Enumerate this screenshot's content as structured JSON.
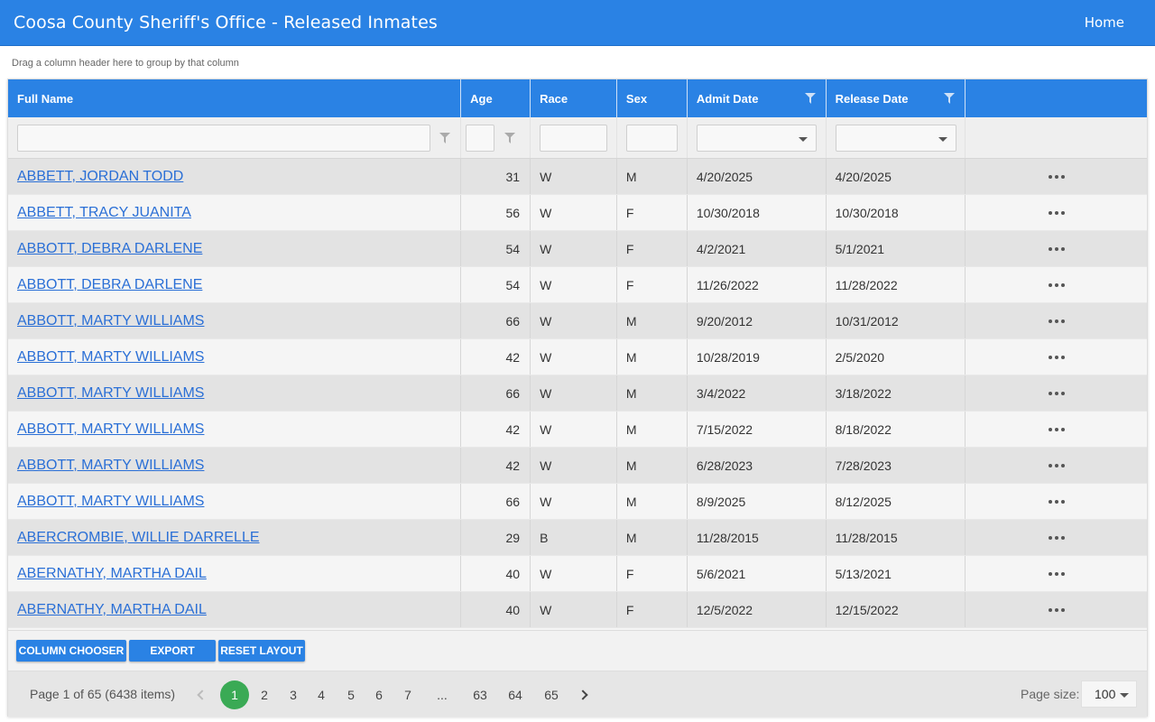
{
  "header": {
    "title": "Coosa County Sheriff's Office - Released Inmates",
    "home_link": "Home"
  },
  "group_hint": "Drag a column header here to group by that column",
  "columns": [
    "Full Name",
    "Age",
    "Race",
    "Sex",
    "Admit Date",
    "Release Date"
  ],
  "rows": [
    {
      "name": "ABBETT, JORDAN TODD",
      "age": "31",
      "race": "W",
      "sex": "M",
      "admit": "4/20/2025",
      "release": "4/20/2025"
    },
    {
      "name": "ABBETT, TRACY JUANITA",
      "age": "56",
      "race": "W",
      "sex": "F",
      "admit": "10/30/2018",
      "release": "10/30/2018"
    },
    {
      "name": "ABBOTT, DEBRA DARLENE",
      "age": "54",
      "race": "W",
      "sex": "F",
      "admit": "4/2/2021",
      "release": "5/1/2021"
    },
    {
      "name": "ABBOTT, DEBRA DARLENE",
      "age": "54",
      "race": "W",
      "sex": "F",
      "admit": "11/26/2022",
      "release": "11/28/2022"
    },
    {
      "name": "ABBOTT, MARTY WILLIAMS",
      "age": "66",
      "race": "W",
      "sex": "M",
      "admit": "9/20/2012",
      "release": "10/31/2012"
    },
    {
      "name": "ABBOTT, MARTY WILLIAMS",
      "age": "42",
      "race": "W",
      "sex": "M",
      "admit": "10/28/2019",
      "release": "2/5/2020"
    },
    {
      "name": "ABBOTT, MARTY WILLIAMS",
      "age": "66",
      "race": "W",
      "sex": "M",
      "admit": "3/4/2022",
      "release": "3/18/2022"
    },
    {
      "name": "ABBOTT, MARTY WILLIAMS",
      "age": "42",
      "race": "W",
      "sex": "M",
      "admit": "7/15/2022",
      "release": "8/18/2022"
    },
    {
      "name": "ABBOTT, MARTY WILLIAMS",
      "age": "42",
      "race": "W",
      "sex": "M",
      "admit": "6/28/2023",
      "release": "7/28/2023"
    },
    {
      "name": "ABBOTT, MARTY WILLIAMS",
      "age": "66",
      "race": "W",
      "sex": "M",
      "admit": "8/9/2025",
      "release": "8/12/2025"
    },
    {
      "name": "ABERCROMBIE, WILLIE DARRELLE",
      "age": "29",
      "race": "B",
      "sex": "M",
      "admit": "11/28/2015",
      "release": "11/28/2015"
    },
    {
      "name": "ABERNATHY, MARTHA DAIL",
      "age": "40",
      "race": "W",
      "sex": "F",
      "admit": "5/6/2021",
      "release": "5/13/2021"
    },
    {
      "name": "ABERNATHY, MARTHA DAIL",
      "age": "40",
      "race": "W",
      "sex": "F",
      "admit": "12/5/2022",
      "release": "12/15/2022"
    }
  ],
  "buttons": {
    "column_chooser": "COLUMN CHOOSER",
    "export": "EXPORT",
    "reset_layout": "RESET LAYOUT"
  },
  "pager": {
    "info": "Page 1 of 65 (6438 items)",
    "pages": [
      "1",
      "2",
      "3",
      "4",
      "5",
      "6",
      "7",
      "...",
      "63",
      "64",
      "65"
    ],
    "current": "1",
    "page_size_label": "Page size:",
    "page_size": "100"
  },
  "colors": {
    "header_bg": "#2a82e4",
    "link": "#2a6fd6",
    "active_page": "#3aaa55"
  },
  "icons": {
    "filter": "filter-icon",
    "dropdown": "chevron-down-icon",
    "row_menu": "more-horizontal-icon"
  }
}
